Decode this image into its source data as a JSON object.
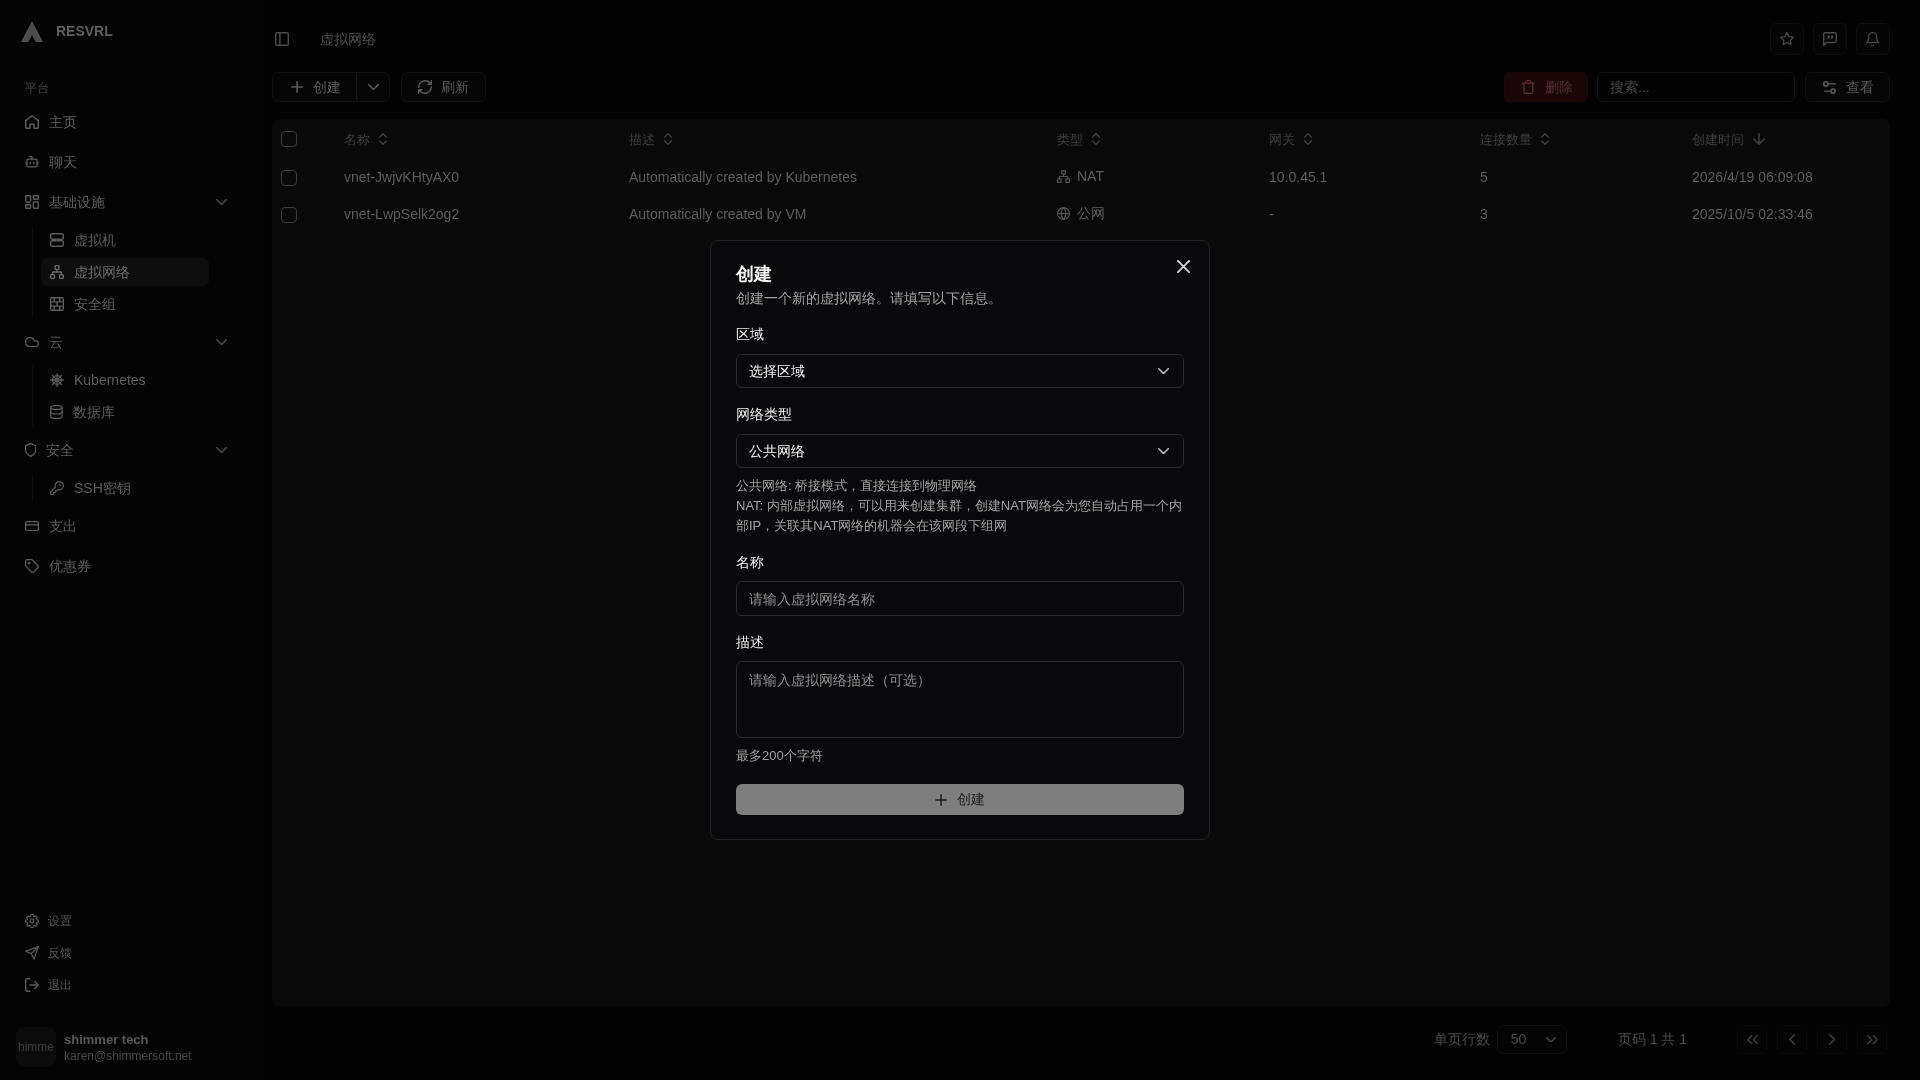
{
  "sidebar": {
    "brand": "RESVRL",
    "section_label": "平台",
    "items": [
      {
        "label": "主页",
        "selected": false
      },
      {
        "label": "聊天",
        "selected": false
      },
      {
        "label": "基础设施",
        "selected": false,
        "expanded": true,
        "children": [
          {
            "label": "虚拟机",
            "selected": false
          },
          {
            "label": "虚拟网络",
            "selected": true
          },
          {
            "label": "安全组",
            "selected": false
          }
        ]
      },
      {
        "label": "云",
        "selected": false,
        "expanded": true,
        "children": [
          {
            "label": "Kubernetes",
            "selected": false
          },
          {
            "label": "数据库",
            "selected": false
          }
        ]
      },
      {
        "label": "安全",
        "selected": false,
        "expanded": true,
        "children": [
          {
            "label": "SSH密钥",
            "selected": false
          }
        ]
      },
      {
        "label": "支出",
        "selected": false
      },
      {
        "label": "优惠券",
        "selected": false
      }
    ],
    "footer_items": [
      {
        "label": "设置"
      },
      {
        "label": "反馈"
      },
      {
        "label": "退出"
      }
    ],
    "user": {
      "avatar_text": "himme",
      "name": "shimmer tech",
      "email": "karen@shimmersoft.net"
    }
  },
  "header": {
    "breadcrumb": "虚拟网络"
  },
  "toolbar": {
    "create": {
      "label": "创建"
    },
    "refresh": {
      "label": "刷新"
    },
    "delete": {
      "label": "删除"
    },
    "search": {
      "placeholder": "搜索..."
    },
    "view": {
      "label": "查看"
    }
  },
  "table": {
    "select_all": {
      "checked": false
    },
    "columns": [
      {
        "label": "名称",
        "sorted": false
      },
      {
        "label": "描述",
        "sorted": false
      },
      {
        "label": "类型",
        "sorted": false
      },
      {
        "label": "网关",
        "sorted": false
      },
      {
        "label": "连接数量",
        "sorted": false
      },
      {
        "label": "创建时间",
        "sorted": true
      }
    ],
    "rows": [
      {
        "checked": false,
        "name": "vnet-JwjvKHtyAX0",
        "description": "Automatically created by Kubernetes",
        "type": {
          "kind": "nat",
          "label": "NAT"
        },
        "gateway": "10.0.45.1",
        "connections": "5",
        "created": "2026/4/19 06:09:08"
      },
      {
        "checked": false,
        "name": "vnet-LwpSelk2og2",
        "description": "Automatically created by VM",
        "type": {
          "kind": "public",
          "label": "公网"
        },
        "gateway": "-",
        "connections": "3",
        "created": "2025/10/5 02:33:46"
      }
    ]
  },
  "pagination": {
    "rows_per_page_label": "单页行数",
    "rows_per_page": "50",
    "page_info": "页码 1 共 1"
  },
  "modal": {
    "title": "创建",
    "description": "创建一个新的虚拟网络。请填写以下信息。",
    "fields": [
      {
        "kind": "select",
        "label": "区域",
        "value": "选择区域"
      },
      {
        "kind": "select",
        "label": "网络类型",
        "value": "公共网络",
        "help": [
          "公共网络: 桥接模式，直接连接到物理网络",
          "NAT: 内部虚拟网络，可以用来创建集群，创建NAT网络会为您自动占用一个内部IP，关联其NAT网络的机器会在该网段下组网"
        ]
      },
      {
        "kind": "input",
        "label": "名称",
        "placeholder": "请输入虚拟网络名称"
      },
      {
        "kind": "textarea",
        "label": "描述",
        "placeholder": "请输入虚拟网络描述（可选）",
        "help": [
          "最多200个字符"
        ]
      }
    ],
    "submit": {
      "label": "创建",
      "disabled": true
    }
  }
}
